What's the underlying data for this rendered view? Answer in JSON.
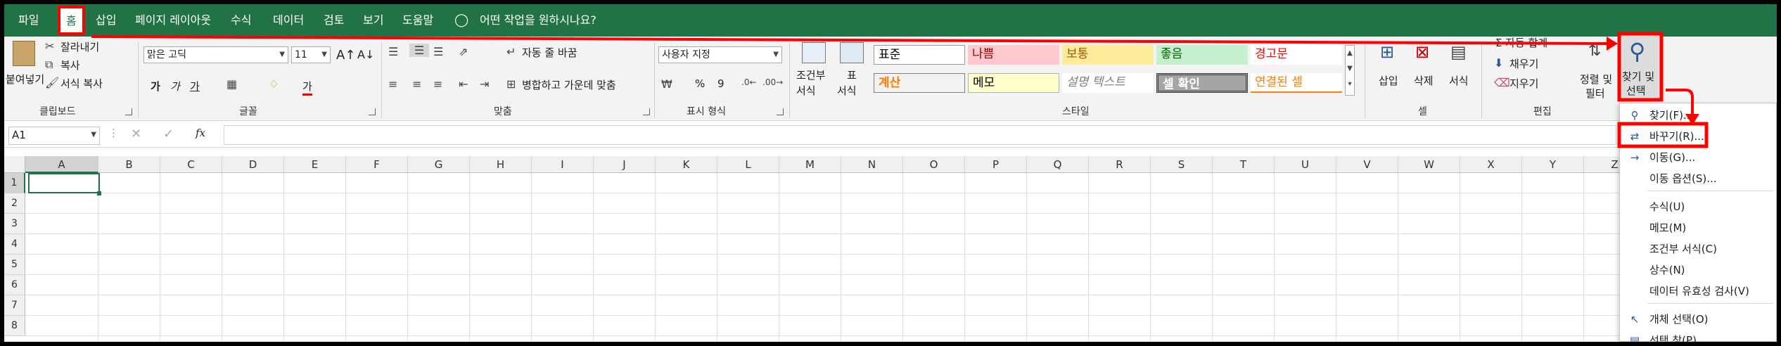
{
  "menu": {
    "tabs": [
      "파일",
      "홈",
      "삽입",
      "페이지 레이아웃",
      "수식",
      "데이터",
      "검토",
      "보기",
      "도움말"
    ],
    "tell_me": "어떤 작업을 원하시나요?"
  },
  "clipboard": {
    "paste": "붙여넣기",
    "cut": "잘라내기",
    "copy": "복사",
    "format_painter": "서식 복사",
    "group": "클립보드"
  },
  "font": {
    "name": "맑은 고딕",
    "size": "11",
    "bold": "가",
    "italic": "가",
    "underline": "가",
    "color_label": "가",
    "group": "글꼴"
  },
  "align": {
    "wrap": "자동 줄 바꿈",
    "merge": "병합하고 가운데 맞춤",
    "group": "맞춤"
  },
  "number": {
    "format": "사용자 지정",
    "percent": "%",
    "comma": "9",
    "group": "표시 형식"
  },
  "styles": {
    "cond_fmt_1": "조건부",
    "cond_fmt_2": "서식",
    "table_1": "표",
    "table_2": "서식",
    "normal": "표준",
    "bad": "나쁨",
    "neutral": "보통",
    "good": "좋음",
    "warning": "경고문",
    "calc": "계산",
    "memo": "메모",
    "explanatory": "설명 텍스트",
    "check": "셀 확인",
    "linked": "연결된 셀",
    "group": "스타일"
  },
  "cells": {
    "insert": "삽입",
    "delete": "삭제",
    "format": "서식",
    "group": "셀"
  },
  "editing": {
    "autosum": "자동 합계",
    "fill": "채우기",
    "clear": "지우기",
    "sort_1": "정렬 및",
    "sort_2": "필터",
    "find_1": "찾기 및",
    "find_2": "선택",
    "group": "편집"
  },
  "formula_bar": {
    "name_box": "A1",
    "fx": "fx",
    "value": ""
  },
  "columns": [
    "A",
    "B",
    "C",
    "D",
    "E",
    "F",
    "G",
    "H",
    "I",
    "J",
    "K",
    "L",
    "M",
    "N",
    "O",
    "P",
    "Q",
    "R",
    "S",
    "T",
    "U",
    "V",
    "W",
    "X",
    "Y",
    "Z"
  ],
  "rows": [
    "1",
    "2",
    "3",
    "4",
    "5",
    "6",
    "7",
    "8"
  ],
  "dropdown": {
    "items": [
      {
        "label": "찾기(F)...",
        "icon": "search-icon"
      },
      {
        "label": "바꾸기(R)...",
        "icon": "replace-icon"
      },
      {
        "label": "이동(G)...",
        "icon": "arrow-right-icon"
      },
      {
        "label": "이동 옵션(S)...",
        "icon": ""
      },
      {
        "label": "수식(U)",
        "icon": ""
      },
      {
        "label": "메모(M)",
        "icon": ""
      },
      {
        "label": "조건부 서식(C)",
        "icon": ""
      },
      {
        "label": "상수(N)",
        "icon": ""
      },
      {
        "label": "데이터 유효성 검사(V)",
        "icon": ""
      },
      {
        "label": "개체 선택(O)",
        "icon": "cursor-icon"
      },
      {
        "label": "선택 창(P)...",
        "icon": "selection-pane-icon"
      }
    ]
  },
  "colors": {
    "accent": "#217346",
    "highlight": "#ff0000"
  }
}
